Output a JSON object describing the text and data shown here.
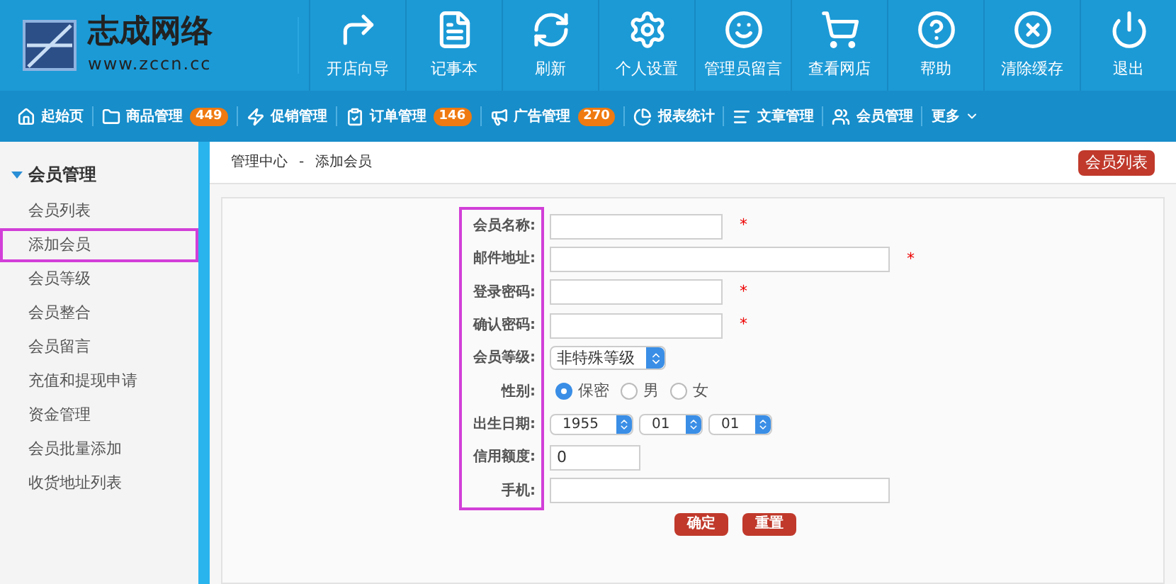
{
  "logo": {
    "name": "志成网络",
    "url": "www.zccn.cc"
  },
  "toolbar": [
    {
      "label": "开店向导"
    },
    {
      "label": "记事本"
    },
    {
      "label": "刷新"
    },
    {
      "label": "个人设置"
    },
    {
      "label": "管理员留言"
    },
    {
      "label": "查看网店"
    },
    {
      "label": "帮助"
    },
    {
      "label": "清除缓存"
    },
    {
      "label": "退出"
    }
  ],
  "nav": [
    {
      "label": "起始页"
    },
    {
      "label": "商品管理",
      "badge": "449"
    },
    {
      "label": "促销管理"
    },
    {
      "label": "订单管理",
      "badge": "146"
    },
    {
      "label": "广告管理",
      "badge": "270"
    },
    {
      "label": "报表统计"
    },
    {
      "label": "文章管理"
    },
    {
      "label": "会员管理"
    },
    {
      "label": "更多"
    }
  ],
  "sidebar": {
    "heading": "会员管理",
    "items": [
      {
        "label": "会员列表",
        "highlighted": false
      },
      {
        "label": "添加会员",
        "highlighted": true
      },
      {
        "label": "会员等级",
        "highlighted": false
      },
      {
        "label": "会员整合",
        "highlighted": false
      },
      {
        "label": "会员留言",
        "highlighted": false
      },
      {
        "label": "充值和提现申请",
        "highlighted": false
      },
      {
        "label": "资金管理",
        "highlighted": false
      },
      {
        "label": "会员批量添加",
        "highlighted": false
      },
      {
        "label": "收货地址列表",
        "highlighted": false
      }
    ]
  },
  "breadcrumb": [
    "管理中心",
    "-",
    "添加会员"
  ],
  "list_button": "会员列表",
  "form": {
    "labels_highlighted": true,
    "fields": [
      {
        "label": "会员名称:",
        "kind": "short_text",
        "mark": "*"
      },
      {
        "label": "邮件地址:",
        "kind": "long_text",
        "mark": "*"
      },
      {
        "label": "登录密码:",
        "kind": "short_text",
        "mark": "*"
      },
      {
        "label": "确认密码:",
        "kind": "short_text",
        "mark": "*"
      },
      {
        "label": "会员等级:",
        "kind": "select",
        "value": "非特殊等级"
      },
      {
        "label": "性别:",
        "kind": "radio",
        "options": [
          {
            "label": "保密",
            "selected": true
          },
          {
            "label": "男",
            "selected": false
          },
          {
            "label": "女",
            "selected": false
          }
        ]
      },
      {
        "label": "出生日期:",
        "kind": "date",
        "parts": [
          "1955",
          "01",
          "01"
        ]
      },
      {
        "label": "信用额度:",
        "kind": "tiny_text",
        "value": "0"
      },
      {
        "label": "手机:",
        "kind": "long_text"
      }
    ],
    "buttons": [
      "确定",
      "重置"
    ]
  }
}
